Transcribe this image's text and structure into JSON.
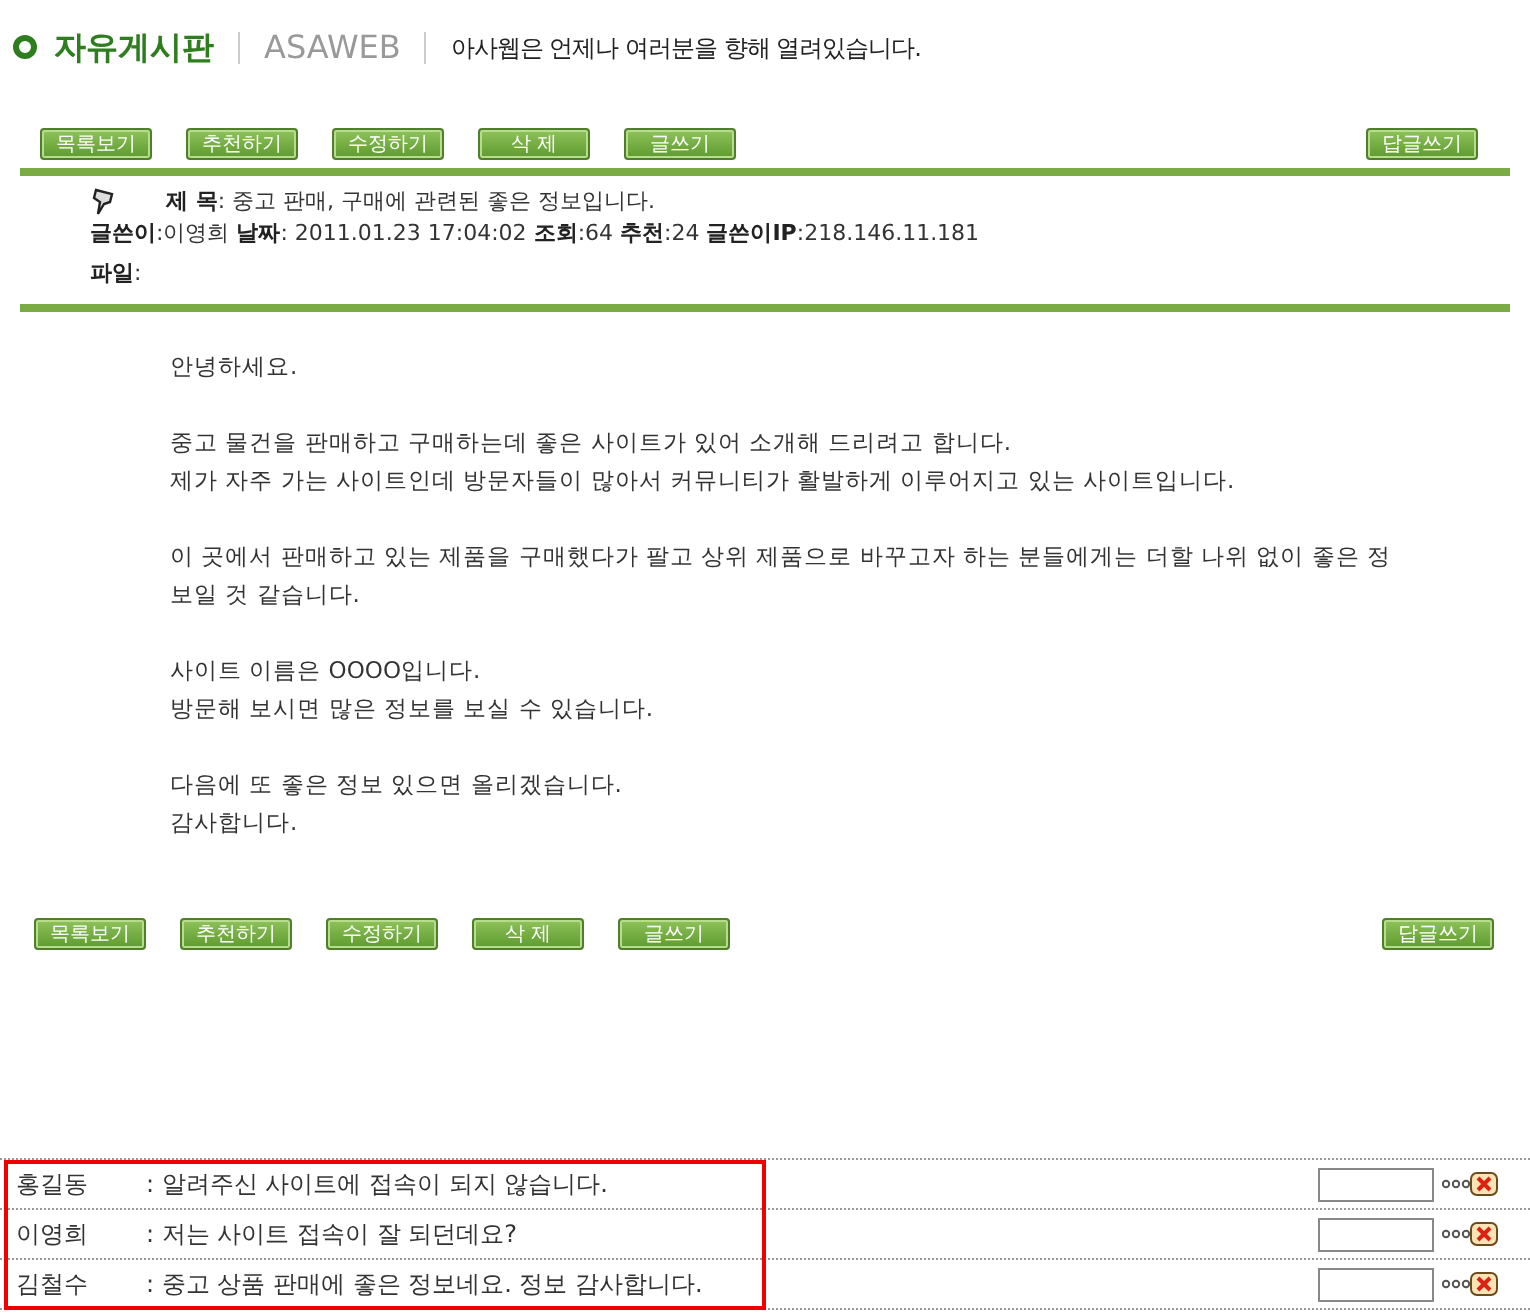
{
  "header": {
    "title": "자유게시판",
    "site": "ASAWEB",
    "slogan": "아사웹은 언제나 여러분을 향해 열려있습니다."
  },
  "toolbar": {
    "buttons": [
      "목록보기",
      "추천하기",
      "수정하기",
      "삭 제",
      "글쓰기"
    ],
    "reply_button": "답글쓰기"
  },
  "post": {
    "subject_label": "제 목",
    "subject": ": 중고 판매, 구매에 관련된 좋은 정보입니다.",
    "meta": [
      {
        "label": "글쓴이",
        "value": ":이영희"
      },
      {
        "label": "날짜",
        "value": ": 2011.01.23 17:04:02"
      },
      {
        "label": "조회",
        "value": ":64"
      },
      {
        "label": "추천",
        "value": ":24"
      },
      {
        "label": "글쓴이IP",
        "value": ":218.146.11.181"
      }
    ],
    "file_label": "파일",
    "file_value": ":",
    "body": [
      [
        "안녕하세요."
      ],
      [
        "중고 물건을 판매하고 구매하는데 좋은 사이트가 있어 소개해 드리려고 합니다.",
        "제가 자주 가는 사이트인데 방문자들이 많아서 커뮤니티가 활발하게 이루어지고 있는 사이트입니다."
      ],
      [
        "이 곳에서 판매하고 있는 제품을 구매했다가 팔고 상위 제품으로 바꾸고자 하는 분들에게는 더할 나위 없이 좋은 정",
        "보일 것 같습니다."
      ],
      [
        "사이트 이름은 OOOO입니다.",
        "방문해 보시면 많은 정보를 보실 수 있습니다."
      ],
      [
        "다음에 또 좋은 정보 있으면 올리겠습니다.",
        "감사합니다."
      ]
    ]
  },
  "bottom_toolbar": {
    "buttons": [
      "목록보기",
      "추천하기",
      "수정하기",
      "삭 제",
      "글쓰기"
    ],
    "reply_button": "답글쓰기"
  },
  "comments": [
    {
      "author": "홍길동",
      "text": ": 알려주신 사이트에 접속이 되지 않습니다."
    },
    {
      "author": "이영희",
      "text": ": 저는 사이트 접속이 잘 되던데요?"
    },
    {
      "author": "김철수",
      "text": ": 중고 상품 판매에 좋은 정보네요. 정보 감사합니다."
    }
  ]
}
